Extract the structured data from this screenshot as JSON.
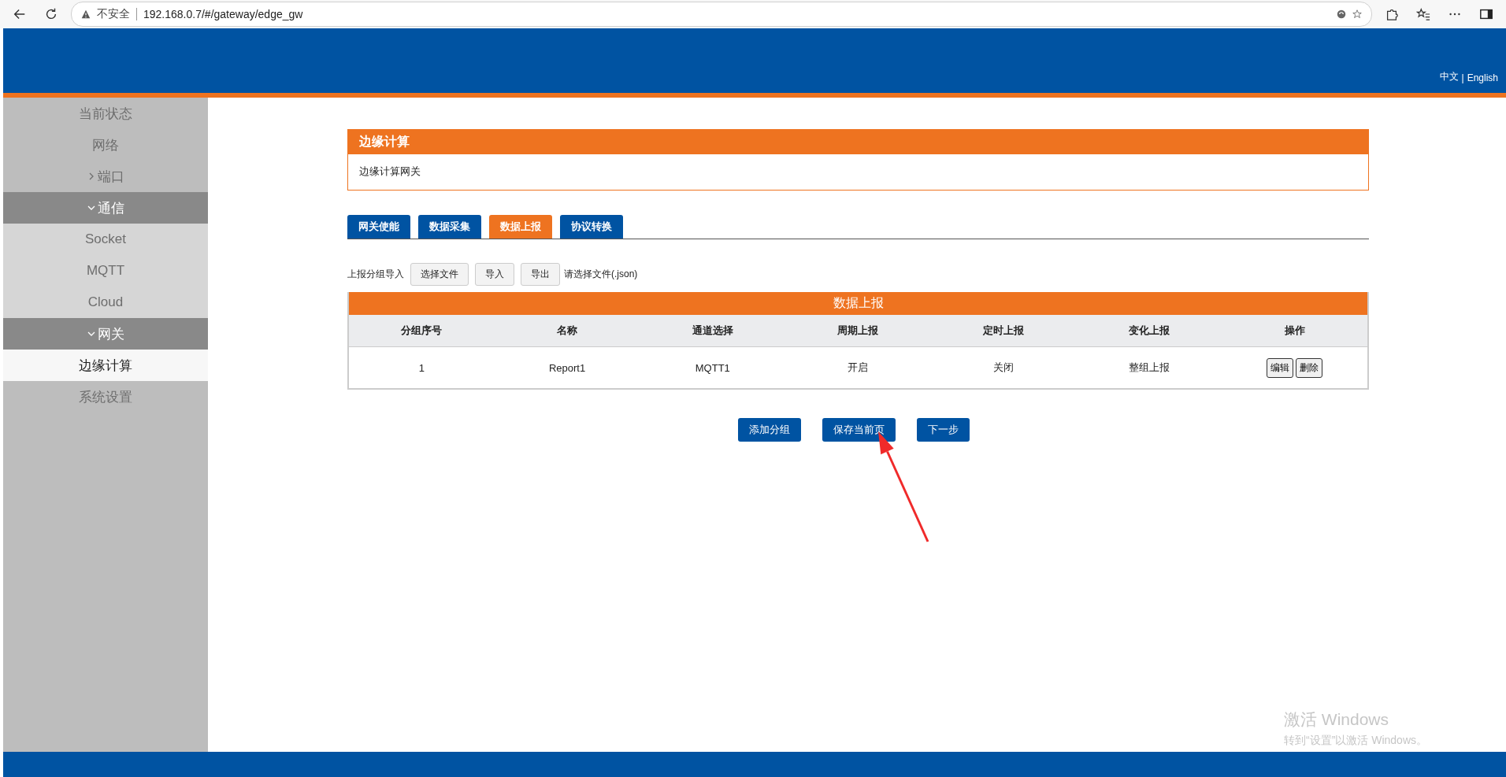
{
  "browser": {
    "security_label": "不安全",
    "url": "192.168.0.7/#/gateway/edge_gw"
  },
  "header": {
    "languages": [
      {
        "label": "中文"
      },
      {
        "label": "English"
      }
    ],
    "separator": "|"
  },
  "sidebar": {
    "items": [
      {
        "label": "当前状态",
        "selected": false
      },
      {
        "label": "网络",
        "selected": false
      },
      {
        "label": "端口",
        "selected": false,
        "expanded": false
      },
      {
        "label": "通信",
        "selected": false,
        "expanded": true,
        "children": [
          {
            "label": "Socket",
            "selected": false
          },
          {
            "label": "MQTT",
            "selected": false
          },
          {
            "label": "Cloud",
            "selected": false
          }
        ]
      },
      {
        "label": "网关",
        "selected": false,
        "expanded": true,
        "children": [
          {
            "label": "边缘计算",
            "selected": true
          }
        ]
      },
      {
        "label": "系统设置",
        "selected": false
      }
    ]
  },
  "panel": {
    "title": "边缘计算",
    "description": "边缘计算网关"
  },
  "tabs": [
    {
      "label": "网关使能",
      "selected": false
    },
    {
      "label": "数据采集",
      "selected": false
    },
    {
      "label": "数据上报",
      "selected": true
    },
    {
      "label": "协议转换",
      "selected": false
    }
  ],
  "import_row": {
    "label": "上报分组导入",
    "buttons": [
      "选择文件",
      "导入",
      "导出"
    ],
    "hint": "请选择文件(.json)"
  },
  "table": {
    "title": "数据上报",
    "columns": [
      "分组序号",
      "名称",
      "通道选择",
      "周期上报",
      "定时上报",
      "变化上报",
      "操作"
    ],
    "rows": [
      {
        "cells": [
          "1",
          "Report1",
          "MQTT1",
          "开启",
          "关闭",
          "整组上报"
        ],
        "actions": [
          "编辑",
          "删除"
        ]
      }
    ]
  },
  "buttons": [
    "添加分组",
    "保存当前页",
    "下一步"
  ],
  "os_overlay": {
    "title": "激活 Windows",
    "subtitle": "转到“设置”以激活 Windows。"
  }
}
